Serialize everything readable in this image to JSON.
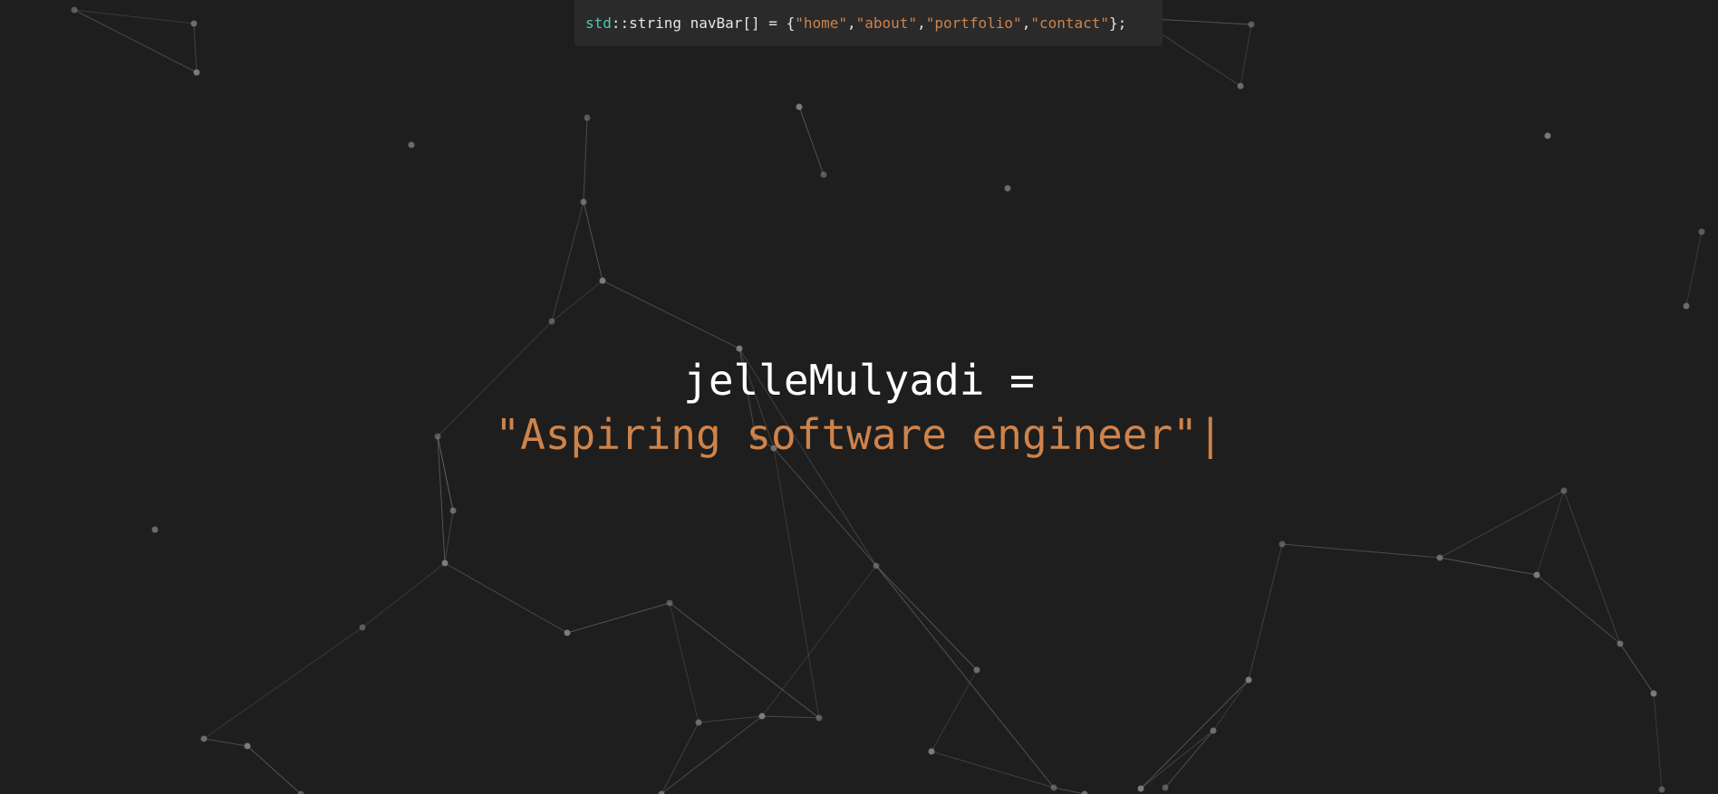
{
  "colors": {
    "background": "#1e1e1e",
    "navbar_background": "#2a2a2a",
    "namespace": "#4ec9b0",
    "string": "#ce834a",
    "text": "#ffffff",
    "particle": "#8a8a8a"
  },
  "navbar": {
    "namespace": "std",
    "scope": "::",
    "declaration": "string navBar[] = {",
    "items": [
      {
        "label": "\"home\""
      },
      {
        "label": "\"about\""
      },
      {
        "label": "\"portfolio\""
      },
      {
        "label": "\"contact\""
      }
    ],
    "separator": ", ",
    "closing": "};"
  },
  "hero": {
    "variable": "jelleMulyadi =",
    "value": "\"Aspiring software engineer\"",
    "cursor": "|"
  }
}
